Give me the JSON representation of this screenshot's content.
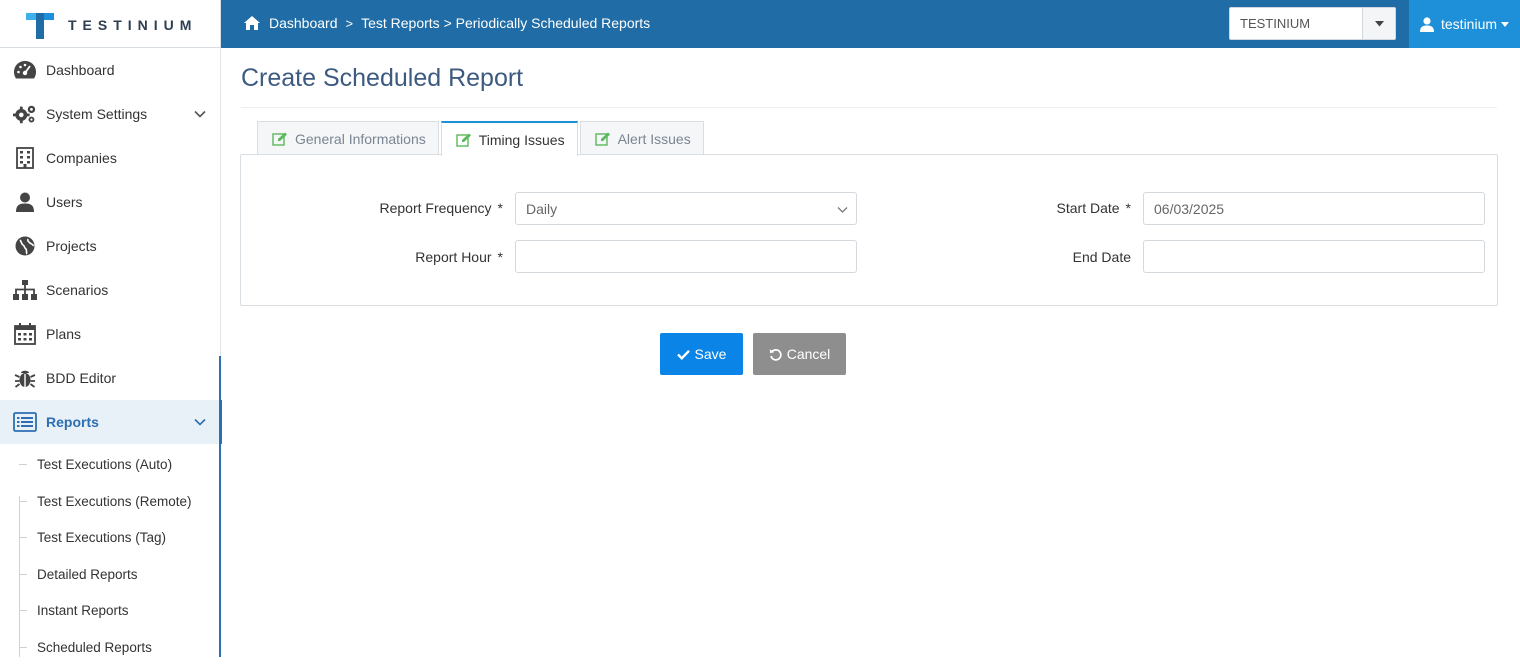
{
  "brand": {
    "name": "TESTINIUM"
  },
  "breadcrumb": {
    "home": "Dashboard",
    "separator": ">",
    "path": "Test Reports > Periodically Scheduled Reports"
  },
  "company_select": {
    "value": "TESTINIUM"
  },
  "user_menu": {
    "username": "testinium"
  },
  "sidebar": {
    "items": [
      {
        "label": "Dashboard",
        "icon": "dashboard-icon"
      },
      {
        "label": "System Settings",
        "icon": "gears-icon",
        "expandable": true
      },
      {
        "label": "Companies",
        "icon": "building-icon"
      },
      {
        "label": "Users",
        "icon": "user-icon"
      },
      {
        "label": "Projects",
        "icon": "globe-icon"
      },
      {
        "label": "Scenarios",
        "icon": "sitemap-icon"
      },
      {
        "label": "Plans",
        "icon": "calendar-icon"
      },
      {
        "label": "BDD Editor",
        "icon": "bug-icon"
      },
      {
        "label": "Reports",
        "icon": "list-alt-icon",
        "expandable": true,
        "active": true
      }
    ],
    "report_subitems": [
      "Test Executions (Auto)",
      "Test Executions (Remote)",
      "Test Executions (Tag)",
      "Detailed Reports",
      "Instant Reports",
      "Scheduled Reports"
    ]
  },
  "page": {
    "title": "Create Scheduled Report"
  },
  "tabs": [
    {
      "label": "General Informations",
      "active": false
    },
    {
      "label": "Timing Issues",
      "active": true
    },
    {
      "label": "Alert Issues",
      "active": false
    }
  ],
  "form": {
    "report_frequency": {
      "label": "Report Frequency",
      "required": "*",
      "value": "Daily"
    },
    "report_hour": {
      "label": "Report Hour",
      "required": "*",
      "value": ""
    },
    "start_date": {
      "label": "Start Date",
      "required": "*",
      "value": "06/03/2025"
    },
    "end_date": {
      "label": "End Date",
      "value": ""
    }
  },
  "buttons": {
    "save": "Save",
    "cancel": "Cancel"
  },
  "colors": {
    "topbar": "#1f6ca6",
    "user_menu": "#1e90d9",
    "save": "#0a84e6",
    "cancel": "#8e8e8e",
    "active_nav": "#2d6fb0",
    "tab_icon": "#5cb85c"
  }
}
